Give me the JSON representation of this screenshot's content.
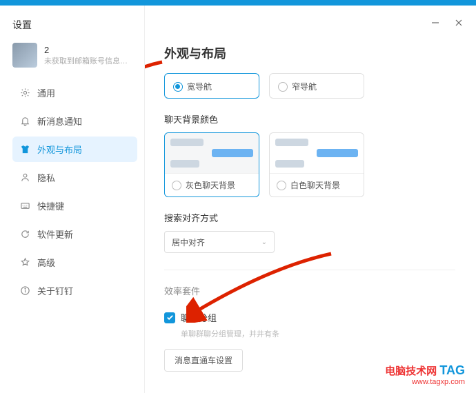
{
  "window": {
    "settings_title": "设置",
    "user": {
      "name": "2",
      "subtitle": "未获取到邮箱账号信息…"
    }
  },
  "nav": {
    "items": [
      {
        "label": "通用"
      },
      {
        "label": "新消息通知"
      },
      {
        "label": "外观与布局"
      },
      {
        "label": "隐私"
      },
      {
        "label": "快捷键"
      },
      {
        "label": "软件更新"
      },
      {
        "label": "高级"
      },
      {
        "label": "关于钉钉"
      }
    ]
  },
  "content": {
    "h1": "外观与布局",
    "nav_cards": {
      "wide": "宽导航",
      "narrow": "窄导航",
      "selected": "wide"
    },
    "bg_section": {
      "title": "聊天背景颜色",
      "gray": "灰色聊天背景",
      "white": "白色聊天背景",
      "selected": "gray"
    },
    "align_section": {
      "title": "搜索对齐方式",
      "value": "居中对齐"
    },
    "suite": {
      "title": "效率套件",
      "group_chat": "聊天分组",
      "group_chat_desc": "单聊群聊分组管理，并井有条",
      "express_btn": "消息直通车设置"
    }
  },
  "watermark": {
    "line1_a": "电脑技术网",
    "line1_b": "TAG",
    "line2": "www.tagxp.com"
  }
}
